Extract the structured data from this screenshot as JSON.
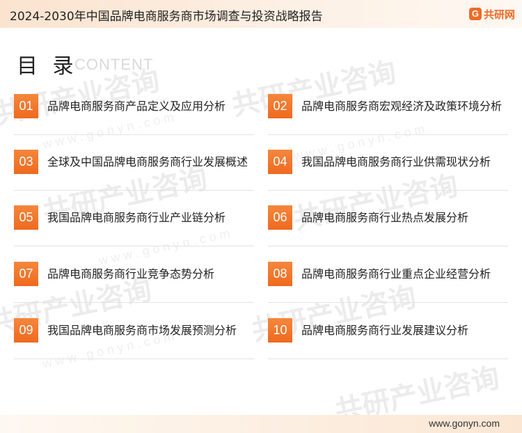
{
  "header": {
    "title": "2024-2030年中国品牌电商服务商市场调查与投资战略报告",
    "brand": "共研网",
    "brand_icon": "G"
  },
  "toc": {
    "heading": "目 录",
    "heading_sub": "CONTENT",
    "items": [
      {
        "num": "01",
        "label": "品牌电商服务商产品定义及应用分析"
      },
      {
        "num": "02",
        "label": "品牌电商服务商宏观经济及政策环境分析"
      },
      {
        "num": "03",
        "label": "全球及中国品牌电商服务商行业发展概述"
      },
      {
        "num": "04",
        "label": "我国品牌电商服务商行业供需现状分析"
      },
      {
        "num": "05",
        "label": "我国品牌电商服务商行业产业链分析"
      },
      {
        "num": "06",
        "label": "品牌电商服务商行业热点发展分析"
      },
      {
        "num": "07",
        "label": "品牌电商服务商行业竞争态势分析"
      },
      {
        "num": "08",
        "label": "品牌电商服务商行业重点企业经营分析"
      },
      {
        "num": "09",
        "label": "我国品牌电商服务商市场发展预测分析"
      },
      {
        "num": "10",
        "label": "品牌电商服务商行业发展建议分析"
      }
    ]
  },
  "watermark": {
    "text": "共研产业咨询",
    "url": "w w w . g o n y n . c o m",
    "color": "#e9e9e9"
  },
  "footer": {
    "url": "www.gonyn.com"
  },
  "colors": {
    "accent": "#f06a26",
    "number_box": "#ee6a1f"
  }
}
